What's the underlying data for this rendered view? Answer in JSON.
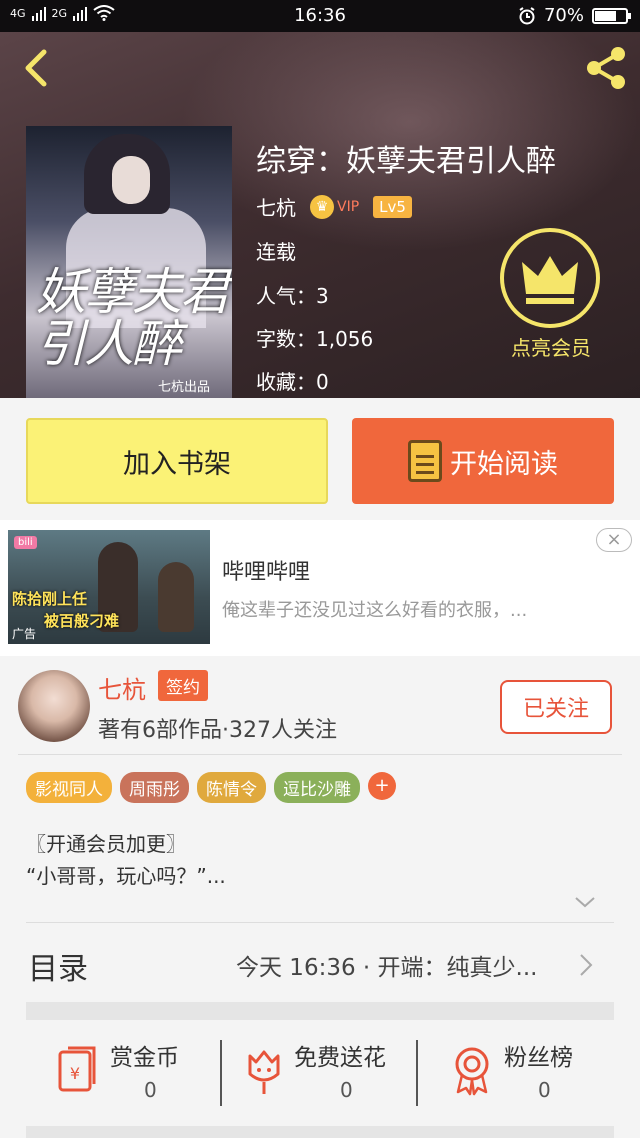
{
  "status_bar": {
    "network_labels": [
      "4G",
      "2G"
    ],
    "time": "16:36",
    "battery": "70%",
    "battery_level": 0.7
  },
  "book": {
    "title": "综穿：妖孽夫君引人醉",
    "author": "七杭",
    "vip_label": "VIP",
    "level": "Lv5",
    "status": "连载",
    "popularity": "人气：3",
    "word_count": "字数：1,056",
    "favorites": "收藏：0",
    "cover_title": "妖孽夫君引人醉",
    "cover_publisher": "七杭出品"
  },
  "vip_promo": {
    "label": "点亮会员"
  },
  "actions": {
    "add_shelf": "加入书架",
    "start_reading": "开始阅读"
  },
  "ad": {
    "title": "哔哩哔哩",
    "desc": "俺这辈子还没见过这么好看的衣服，...",
    "caption1": "陈拾刚上任",
    "caption2": "被百般刁难",
    "tag": "广告",
    "close": "×"
  },
  "author": {
    "name": "七杭",
    "signed": "签约",
    "stats": "著有6部作品·327人关注",
    "follow": "已关注"
  },
  "tags": [
    {
      "label": "影视同人",
      "color": "#f3b13b"
    },
    {
      "label": "周雨彤",
      "color": "#c9735b"
    },
    {
      "label": "陈情令",
      "color": "#e0a93d"
    },
    {
      "label": "逗比沙雕",
      "color": "#8bb05a"
    }
  ],
  "tag_add": "+",
  "blurb": {
    "line1": "〖开通会员加更〗",
    "line2": "“小哥哥，玩心吗？”..."
  },
  "catalog": {
    "label": "目录",
    "latest": "今天 16:36 · 开端：纯真少..."
  },
  "rewards": [
    {
      "label": "赏金币",
      "count": "0"
    },
    {
      "label": "免费送花",
      "count": "0"
    },
    {
      "label": "粉丝榜",
      "count": "0"
    }
  ],
  "colors": {
    "accent_orange": "#f0673c",
    "shelf_yellow": "#fbf276",
    "vip_gold": "#f5e56a",
    "reward_red": "#e7543a"
  }
}
